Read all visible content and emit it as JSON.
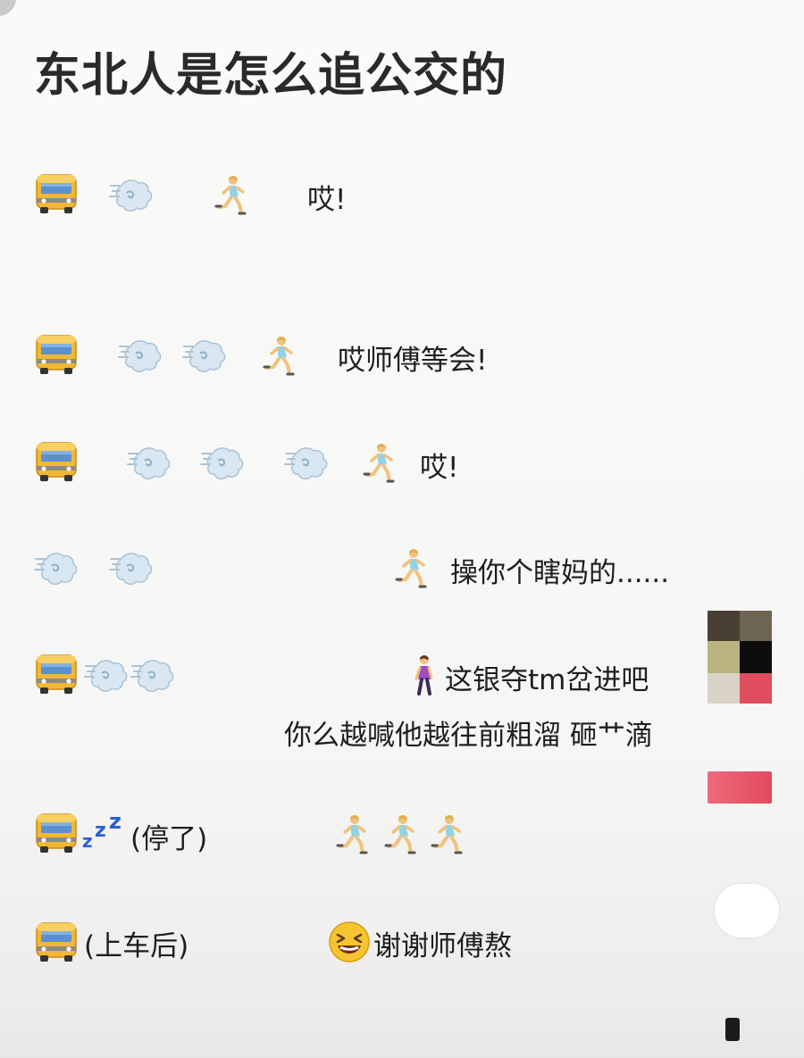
{
  "title": "东北人是怎么追公交的",
  "rows": {
    "r1": {
      "text": "哎!"
    },
    "r2": {
      "text": "哎师傅等会!"
    },
    "r3": {
      "text": "哎!"
    },
    "r4": {
      "text": "操你个瞎妈的......"
    },
    "r5": {
      "text": "这银夺tm岔进吧",
      "text2": "你么越喊他越往前粗溜  砸艹滴"
    },
    "r6": {
      "text": "(停了)"
    },
    "r7": {
      "text": "(上车后)",
      "text2": "谢谢师傅熬"
    }
  },
  "icons": [
    "bus-icon",
    "dash-cloud-icon",
    "running-woman-icon",
    "walking-woman-icon",
    "sleeping-zzz-icon",
    "laughing-face-icon"
  ],
  "colors": {
    "bus_body": "#f2b833",
    "bus_window": "#5b8fcf",
    "cloud": "#cfe3ef",
    "runner_shirt": "#8fd3e8"
  }
}
